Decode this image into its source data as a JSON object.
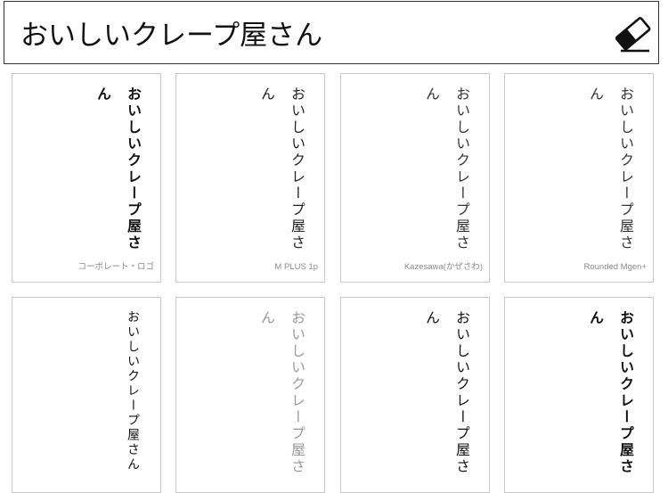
{
  "header": {
    "input_value": "おいしいクレープ屋さん",
    "eraser_icon": "eraser-icon"
  },
  "cards": [
    {
      "text": "おいしいクレープ屋さん",
      "label": "コーポレート・ロゴ"
    },
    {
      "text": "おいしいクレープ屋さん",
      "label": "M PLUS 1p"
    },
    {
      "text": "おいしいクレープ屋さん",
      "label": "Kazesawa(かぜさわ)"
    },
    {
      "text": "おいしいクレープ屋さん",
      "label": "Rounded Mgen+"
    },
    {
      "text": "おいしいクレープ屋さん",
      "label": ""
    },
    {
      "text": "おいしいクレープ屋さん",
      "label": ""
    },
    {
      "text": "おいしいクレープ屋さん",
      "label": ""
    },
    {
      "text": "おいしいクレープ屋さん",
      "label": ""
    }
  ]
}
